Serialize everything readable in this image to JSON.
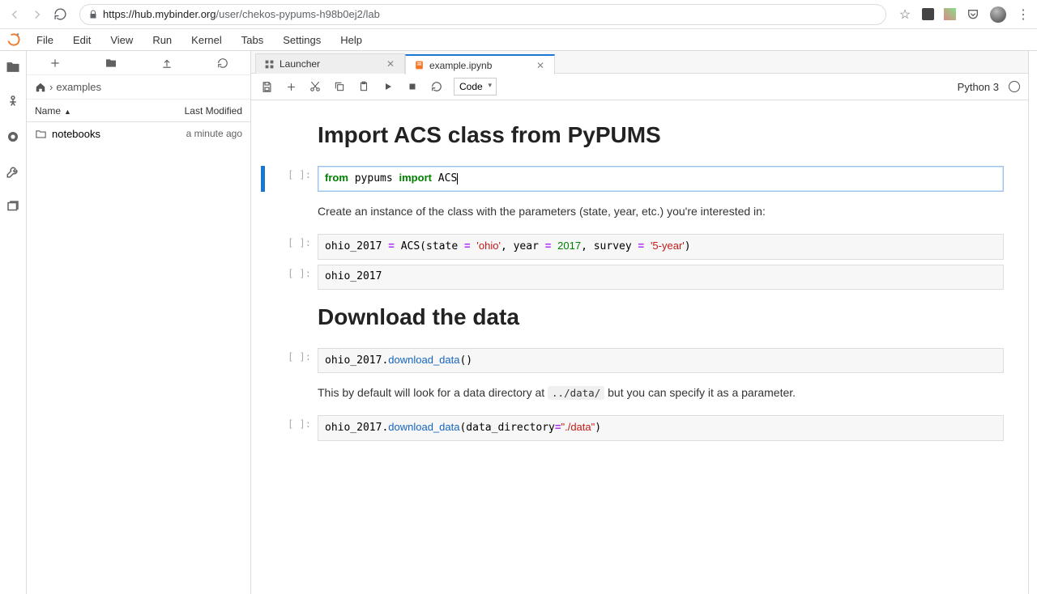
{
  "browser": {
    "url_prefix": "https://",
    "url_domain": "hub.mybinder.org",
    "url_path": "/user/chekos-pypums-h98b0ej2/lab"
  },
  "menu": {
    "items": [
      "File",
      "Edit",
      "View",
      "Run",
      "Kernel",
      "Tabs",
      "Settings",
      "Help"
    ]
  },
  "activity_icons": [
    "folder",
    "running",
    "commands",
    "palette",
    "wrench",
    "tabs"
  ],
  "filebrowser": {
    "breadcrumb_root": "🏠",
    "breadcrumb_sep": "›",
    "breadcrumb_item": "examples",
    "header_name": "Name",
    "header_modified": "Last Modified",
    "rows": [
      {
        "icon": "folder",
        "name": "notebooks",
        "modified": "a minute ago"
      }
    ]
  },
  "tabs": [
    {
      "icon": "launcher",
      "label": "Launcher",
      "active": false
    },
    {
      "icon": "notebook",
      "label": "example.ipynb",
      "active": true
    }
  ],
  "toolbar": {
    "celltype": "Code",
    "kernel": "Python 3"
  },
  "notebook": {
    "heading1": "Import ACS class from PyPUMS",
    "cell1_code_plain": "from pypums import ACS",
    "md1": "Create an instance of the class with the parameters (state, year, etc.) you're interested in:",
    "cell2_code_plain": "ohio_2017 = ACS(state = 'ohio', year = 2017, survey = '5-year')",
    "cell3_code_plain": "ohio_2017",
    "heading2": "Download the data",
    "cell4_code_plain": "ohio_2017.download_data()",
    "md2_pre": "This by default will look for a data directory at ",
    "md2_code": "../data/",
    "md2_post": " but you can specify it as a parameter.",
    "cell5_code_plain": "ohio_2017.download_data(data_directory=\"./data\")",
    "prompt_empty": "[ ]:"
  }
}
